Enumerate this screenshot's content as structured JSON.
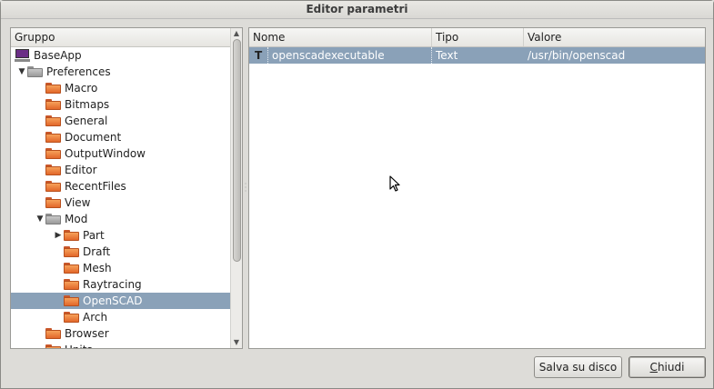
{
  "window": {
    "title": "Editor parametri"
  },
  "left_pane": {
    "header": "Gruppo",
    "items": [
      {
        "label": "BaseApp",
        "icon": "computer-icon",
        "depth": 0,
        "arrow": "",
        "selected": false
      },
      {
        "label": "Preferences",
        "icon": "folder-gray-icon",
        "depth": 0,
        "arrow": "expanded",
        "selected": false
      },
      {
        "label": "Macro",
        "icon": "folder-icon",
        "depth": 1,
        "arrow": "",
        "selected": false
      },
      {
        "label": "Bitmaps",
        "icon": "folder-icon",
        "depth": 1,
        "arrow": "",
        "selected": false
      },
      {
        "label": "General",
        "icon": "folder-icon",
        "depth": 1,
        "arrow": "",
        "selected": false
      },
      {
        "label": "Document",
        "icon": "folder-icon",
        "depth": 1,
        "arrow": "",
        "selected": false
      },
      {
        "label": "OutputWindow",
        "icon": "folder-icon",
        "depth": 1,
        "arrow": "",
        "selected": false
      },
      {
        "label": "Editor",
        "icon": "folder-icon",
        "depth": 1,
        "arrow": "",
        "selected": false
      },
      {
        "label": "RecentFiles",
        "icon": "folder-icon",
        "depth": 1,
        "arrow": "",
        "selected": false
      },
      {
        "label": "View",
        "icon": "folder-icon",
        "depth": 1,
        "arrow": "",
        "selected": false
      },
      {
        "label": "Mod",
        "icon": "folder-gray-icon",
        "depth": 1,
        "arrow": "expanded",
        "selected": false
      },
      {
        "label": "Part",
        "icon": "folder-icon",
        "depth": 2,
        "arrow": "collapsed",
        "selected": false
      },
      {
        "label": "Draft",
        "icon": "folder-icon",
        "depth": 2,
        "arrow": "",
        "selected": false
      },
      {
        "label": "Mesh",
        "icon": "folder-icon",
        "depth": 2,
        "arrow": "",
        "selected": false
      },
      {
        "label": "Raytracing",
        "icon": "folder-icon",
        "depth": 2,
        "arrow": "",
        "selected": false
      },
      {
        "label": "OpenSCAD",
        "icon": "folder-icon",
        "depth": 2,
        "arrow": "",
        "selected": true
      },
      {
        "label": "Arch",
        "icon": "folder-icon",
        "depth": 2,
        "arrow": "",
        "selected": false
      },
      {
        "label": "Browser",
        "icon": "folder-icon",
        "depth": 1,
        "arrow": "",
        "selected": false
      },
      {
        "label": "Units",
        "icon": "folder-icon",
        "depth": 1,
        "arrow": "",
        "selected": false
      }
    ]
  },
  "right_pane": {
    "columns": [
      "Nome",
      "Tipo",
      "Valore"
    ],
    "rows": [
      {
        "type_icon": "T",
        "name": "openscadexecutable",
        "type": "Text",
        "value": "/usr/bin/openscad"
      }
    ]
  },
  "buttons": {
    "save": "Salva su disco",
    "close_mnemonic": "C",
    "close_rest": "hiudi"
  },
  "colors": {
    "selection": "#8aa1b8",
    "folder": "#f08a3c",
    "folder_gray": "#a0a0a0"
  }
}
